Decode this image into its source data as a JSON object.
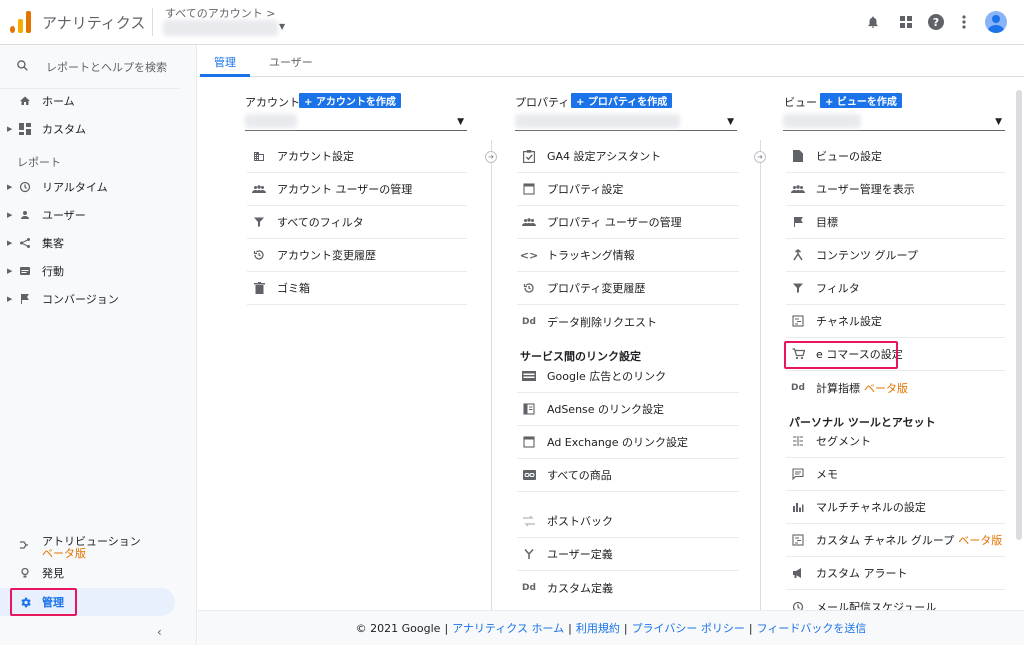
{
  "header": {
    "app_title": "アナリティクス",
    "account_crumb": "すべてのアカウント >"
  },
  "sidebar": {
    "search_placeholder": "レポートとヘルプを検索",
    "items": [
      {
        "label": "ホーム",
        "icon": "home-icon"
      },
      {
        "label": "カスタム",
        "icon": "dashboard-icon"
      }
    ],
    "reports_label": "レポート",
    "reports": [
      {
        "label": "リアルタイム",
        "icon": "clock-icon"
      },
      {
        "label": "ユーザー",
        "icon": "person-icon"
      },
      {
        "label": "集客",
        "icon": "acquisition-icon"
      },
      {
        "label": "行動",
        "icon": "behavior-icon"
      },
      {
        "label": "コンバージョン",
        "icon": "flag-icon"
      }
    ],
    "attribution": {
      "label": "アトリビューション",
      "beta": "ベータ版"
    },
    "discover": "発見",
    "admin": "管理"
  },
  "tabs": [
    "管理",
    "ユーザー"
  ],
  "columns": {
    "account": {
      "title": "アカウント",
      "add_label": "+ アカウントを作成",
      "items": [
        "アカウント設定",
        "アカウント ユーザーの管理",
        "すべてのフィルタ",
        "アカウント変更履歴",
        "ゴミ箱"
      ]
    },
    "property": {
      "title": "プロパティ",
      "add_label": "+ プロパティを作成",
      "items": [
        "GA4 設定アシスタント",
        "プロパティ設定",
        "プロパティ ユーザーの管理",
        "トラッキング情報",
        "プロパティ変更履歴",
        "データ削除リクエスト"
      ],
      "link_heading": "サービス間のリンク設定",
      "link_items": [
        "Google 広告とのリンク",
        "AdSense のリンク設定",
        "Ad Exchange のリンク設定",
        "すべての商品"
      ],
      "extra_items": [
        "ポストバック",
        "ユーザー定義",
        "カスタム定義"
      ]
    },
    "view": {
      "title": "ビュー",
      "add_label": "+ ビューを作成",
      "items": [
        "ビューの設定",
        "ユーザー管理を表示",
        "目標",
        "コンテンツ グループ",
        "フィルタ",
        "チャネル設定",
        "e コマースの設定"
      ],
      "calc_metrics": "計算指標",
      "calc_beta": "ベータ版",
      "personal_heading": "パーソナル ツールとアセット",
      "personal_items": [
        "セグメント",
        "メモ",
        "マルチチャネルの設定"
      ],
      "custom_channel": "カスタム チャネル グループ",
      "custom_channel_beta": "ベータ版",
      "more_items": [
        "カスタム アラート",
        "メール配信スケジュール"
      ]
    }
  },
  "footer": {
    "copyright": "© 2021 Google",
    "links": [
      "アナリティクス ホーム",
      "利用規約",
      "プライバシー ポリシー",
      "フィードバックを送信"
    ]
  },
  "colors": {
    "accent": "#1a73e8",
    "highlight": "#e8175d",
    "beta": "#e37400"
  }
}
